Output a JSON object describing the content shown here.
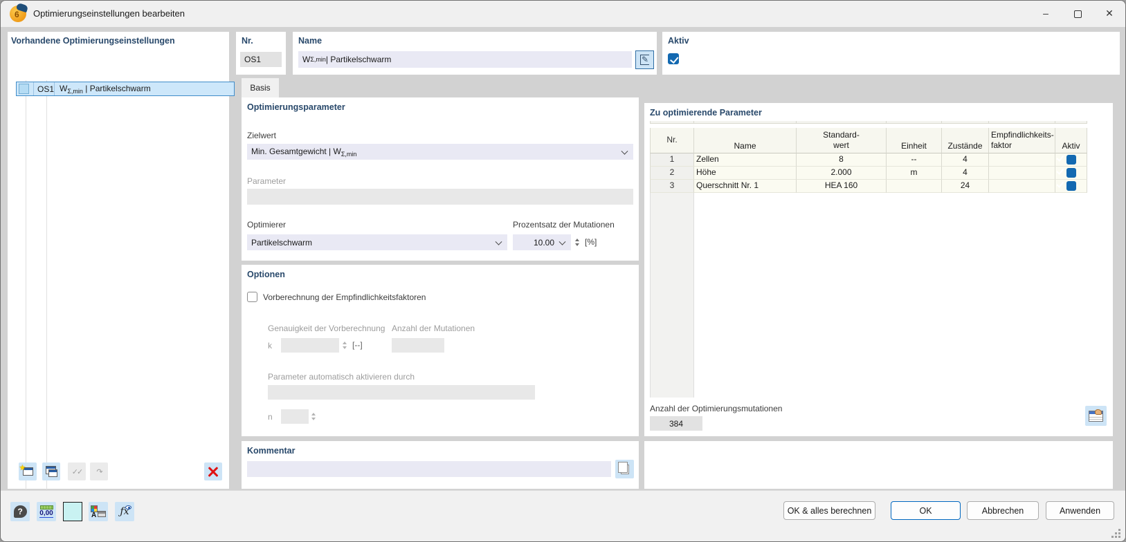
{
  "window": {
    "title": "Optimierungseinstellungen bearbeiten",
    "controls": {
      "minimize": "–",
      "close": "✕"
    }
  },
  "colors": {
    "accent_blue": "#1369b1",
    "selection_bg": "#cde7fa",
    "section_title": "#29496b",
    "input_bg": "#e9e9f4",
    "dialog_bg": "#d2d2d2",
    "delete_red": "#e01212"
  },
  "left_panel": {
    "header": "Vorhandene Optimierungseinstellungen",
    "item": {
      "id": "OS1",
      "name_prefix": "W",
      "name_sub": "Σ,min",
      "name_rest": " | Partikelschwarm"
    },
    "toolbar": {
      "check_glyph": "✓✓",
      "invert_glyph": "↷"
    }
  },
  "header_fields": {
    "nr_label": "Nr.",
    "nr_value": "OS1",
    "name_label": "Name",
    "name_prefix": "W",
    "name_sub": "Σ,min",
    "name_rest": " | Partikelschwarm",
    "aktiv_label": "Aktiv",
    "aktiv_checked": true
  },
  "tabs": [
    {
      "label": "Basis"
    }
  ],
  "optimierungsparameter": {
    "section_title": "Optimierungsparameter",
    "zielwert_label": "Zielwert",
    "zielwert_prefix": "Min. Gesamtgewicht | W",
    "zielwert_sub": "Σ,min",
    "parameter_label": "Parameter",
    "parameter_value": "",
    "optimierer_label": "Optimierer",
    "optimierer_value": "Partikelschwarm",
    "prozentsatz_label": "Prozentsatz der Mutationen",
    "prozentsatz_value": "10.00",
    "prozentsatz_unit": "[%]"
  },
  "optionen": {
    "section_title": "Optionen",
    "vorberechnung_label": "Vorberechnung der Empfindlichkeitsfaktoren",
    "vorberechnung_checked": false,
    "genauigkeit_label": "Genauigkeit der Vorberechnung",
    "k_label": "k",
    "k_value": "",
    "k_unit": "[--]",
    "anzahl_mutationen_label": "Anzahl der Mutationen",
    "anzahl_mutationen_value": "",
    "param_auto_label": "Parameter automatisch aktivieren durch",
    "param_auto_value": "",
    "n_label": "n",
    "n_value": ""
  },
  "kommentar": {
    "section_title": "Kommentar",
    "value": ""
  },
  "parameter_table": {
    "section_title": "Zu optimierende Parameter",
    "columns": [
      "Nr.",
      "Name",
      "Standard-\nwert",
      "Einheit",
      "Zustände",
      "Empfindlichkeits-\nfaktor",
      "Aktiv"
    ],
    "rows": [
      {
        "nr": "1",
        "name": "Zellen",
        "standardwert": "8",
        "einheit": "--",
        "zustaende": "4",
        "empfindlichkeitsfaktor": "",
        "aktiv": true
      },
      {
        "nr": "2",
        "name": "Höhe",
        "standardwert": "2.000",
        "einheit": "m",
        "zustaende": "4",
        "empfindlichkeitsfaktor": "",
        "aktiv": true
      },
      {
        "nr": "3",
        "name": "Querschnitt Nr. 1",
        "standardwert": "HEA 160",
        "einheit": "",
        "zustaende": "24",
        "empfindlichkeitsfaktor": "",
        "aktiv": true
      }
    ],
    "mutations_label": "Anzahl der Optimierungsmutationen",
    "mutations_value": "384"
  },
  "footer": {
    "units_icon_label": "0,00",
    "fx_icon_label": "ƒx",
    "buttons": {
      "ok_all": "OK & alles berechnen",
      "ok": "OK",
      "cancel": "Abbrechen",
      "apply": "Anwenden"
    }
  }
}
